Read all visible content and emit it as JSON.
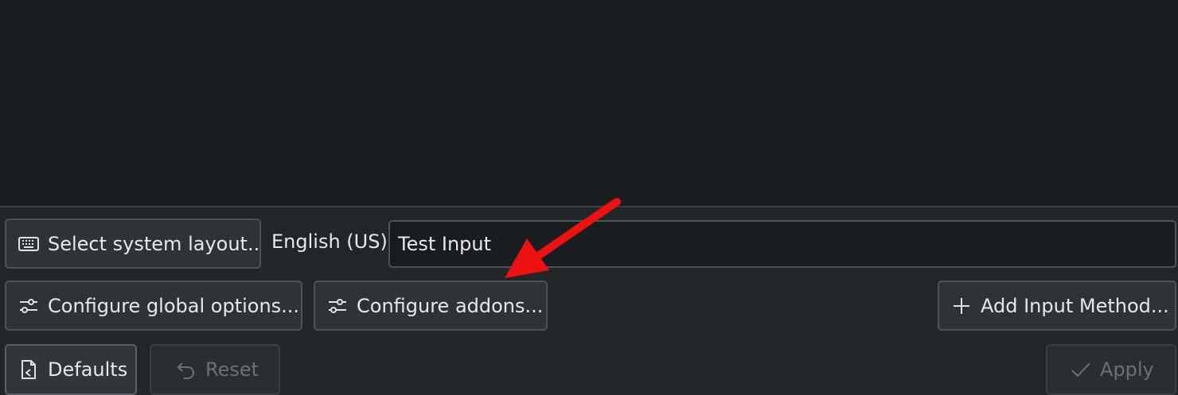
{
  "colors": {
    "accent_arrow": "#ee1111",
    "background": "#232629",
    "list_background": "#1b1e21"
  },
  "row1": {
    "select_layout_label": "Select system layout...",
    "layout_value": "English (US)",
    "test_input_value": "Test Input"
  },
  "row2": {
    "global_options_label": "Configure global options...",
    "addons_label": "Configure addons...",
    "add_input_method_label": "Add Input Method..."
  },
  "footer": {
    "defaults_label": "Defaults",
    "reset_label": "Reset",
    "apply_label": "Apply"
  },
  "icons": {
    "select_layout": "keyboard-icon",
    "global_options": "sliders-icon",
    "addons": "sliders-icon",
    "add_input_method": "plus-icon",
    "defaults": "document-restore-icon",
    "reset": "undo-icon",
    "apply": "checkmark-icon"
  }
}
